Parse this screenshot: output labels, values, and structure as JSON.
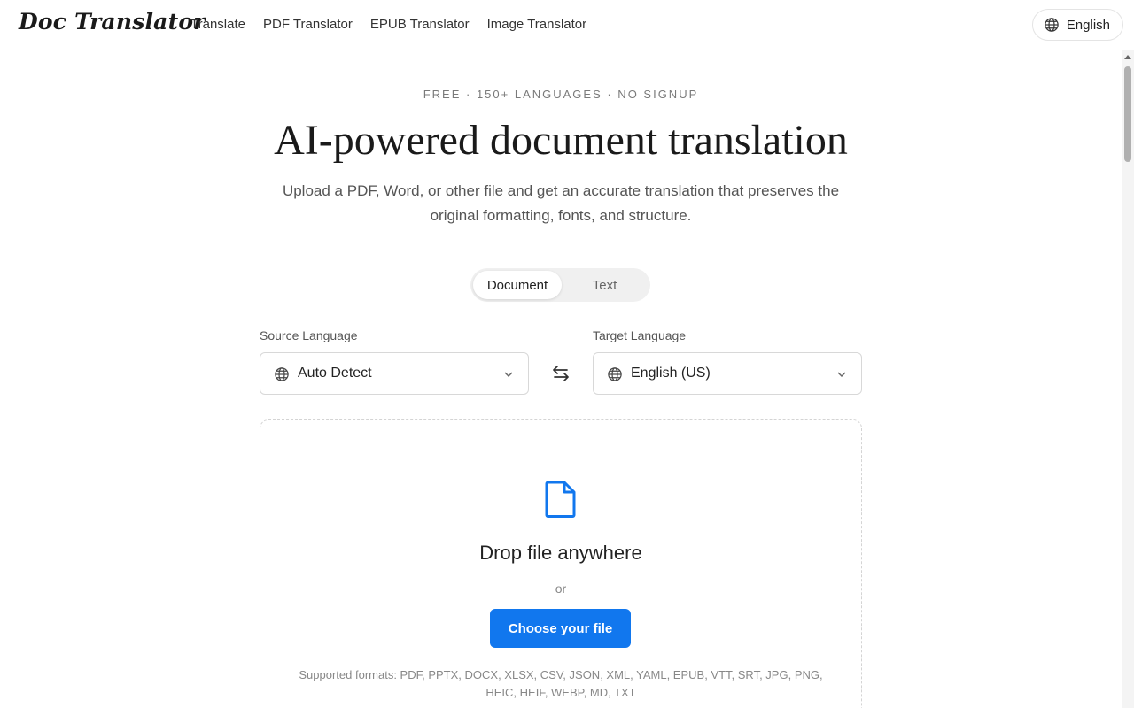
{
  "header": {
    "logo": "Doc Translator",
    "nav": [
      "Translate",
      "PDF Translator",
      "EPUB Translator",
      "Image Translator"
    ],
    "language_button": "English",
    "language_icon": "globe-icon"
  },
  "hero": {
    "eyebrow": "FREE · 150+ LANGUAGES · NO SIGNUP",
    "title": "AI-powered document translation",
    "subtitle": "Upload a PDF, Word, or other file and get an accurate translation that preserves the original formatting, fonts, and structure."
  },
  "mode_toggle": {
    "options": [
      "Document",
      "Text"
    ],
    "selected": "Document"
  },
  "source": {
    "label": "Source Language",
    "value": "Auto Detect"
  },
  "target": {
    "label": "Target Language",
    "value": "English (US)"
  },
  "dropzone": {
    "title": "Drop file anywhere",
    "or": "or",
    "button": "Choose your file",
    "formats": "Supported formats: PDF, PPTX, DOCX, XLSX, CSV, JSON, XML, YAML, EPUB, VTT, SRT, JPG, PNG, HEIC, HEIF, WEBP, MD, TXT"
  },
  "colors": {
    "accent": "#1177ee",
    "file_icon": "#1177ee"
  }
}
